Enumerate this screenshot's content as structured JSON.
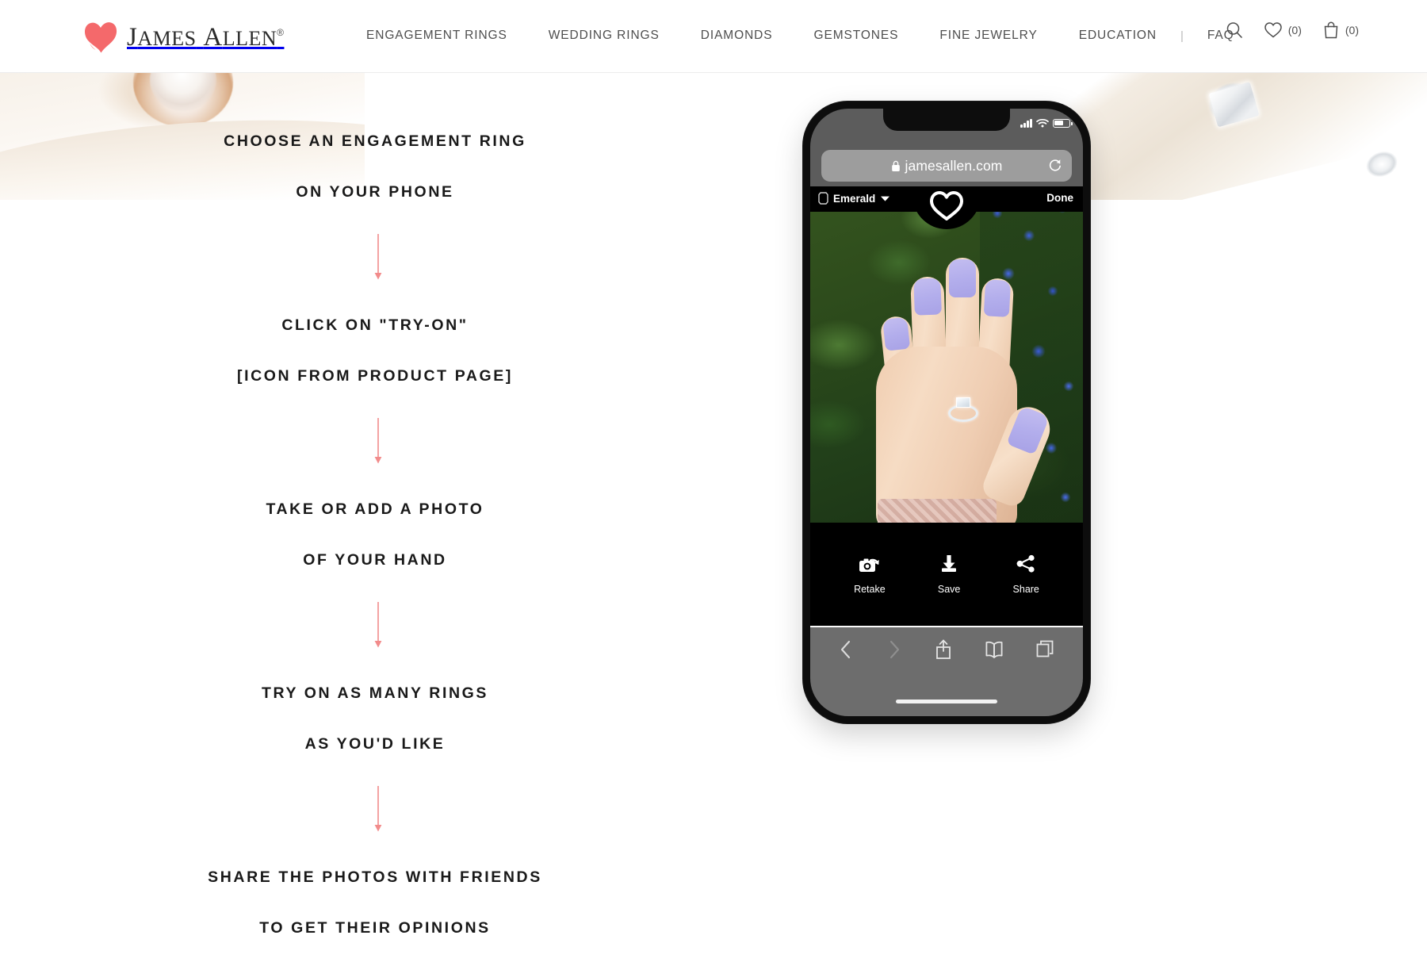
{
  "header": {
    "logo_text_first": "J",
    "logo_text_rest": "AMES",
    "logo_text_second": "A",
    "logo_text_rest2": "LLEN",
    "logo_registered": "®",
    "logo_full": "JAMES ALLEN®",
    "nav": [
      {
        "label": "ENGAGEMENT RINGS"
      },
      {
        "label": "WEDDING RINGS"
      },
      {
        "label": "DIAMONDS"
      },
      {
        "label": "GEMSTONES"
      },
      {
        "label": "FINE JEWELRY"
      },
      {
        "label": "EDUCATION"
      }
    ],
    "nav_divider": "|",
    "faq_label": "FAQ",
    "search_icon": "search-icon",
    "wishlist_icon": "heart-icon",
    "wishlist_count": "(0)",
    "cart_icon": "shopping-bag-icon",
    "cart_count": "(0)"
  },
  "steps": [
    {
      "line1": "CHOOSE AN ENGAGEMENT RING",
      "line2": "ON YOUR PHONE"
    },
    {
      "line1": "CLICK ON \"TRY-ON\"",
      "line2": "[ICON FROM PRODUCT PAGE]"
    },
    {
      "line1": "TAKE OR ADD A PHOTO",
      "line2": "OF YOUR HAND"
    },
    {
      "line1": "TRY ON AS MANY RINGS",
      "line2": "AS YOU'D LIKE"
    },
    {
      "line1": "SHARE THE PHOTOS WITH FRIENDS",
      "line2": "TO GET THEIR OPINIONS"
    }
  ],
  "phone": {
    "browser": {
      "url": "jamesallen.com",
      "lock_icon": "lock-icon",
      "reload_icon": "reload-icon",
      "back_icon": "chevron-left-icon",
      "forward_icon": "chevron-right-icon",
      "share_icon": "share-up-icon",
      "bookmarks_icon": "book-icon",
      "tabs_icon": "tabs-icon"
    },
    "status": {
      "signal_icon": "signal-bars-icon",
      "wifi_icon": "wifi-icon",
      "battery_icon": "battery-icon"
    },
    "app_bar": {
      "shape_icon": "emerald-gem-icon",
      "shape_label": "Emerald",
      "dropdown_icon": "caret-down-icon",
      "favorite_icon": "heart-outline-icon",
      "done_label": "Done"
    },
    "actions": [
      {
        "icon": "camera-retake-icon",
        "label": "Retake"
      },
      {
        "icon": "download-save-icon",
        "label": "Save"
      },
      {
        "icon": "share-nodes-icon",
        "label": "Share"
      }
    ]
  },
  "colors": {
    "accent_pink": "#F28B8B",
    "logo_heart": "#F4696B",
    "text_dark": "#191919",
    "nav_text": "#4E4E4E",
    "banner_cream": "#F5EDE3"
  }
}
